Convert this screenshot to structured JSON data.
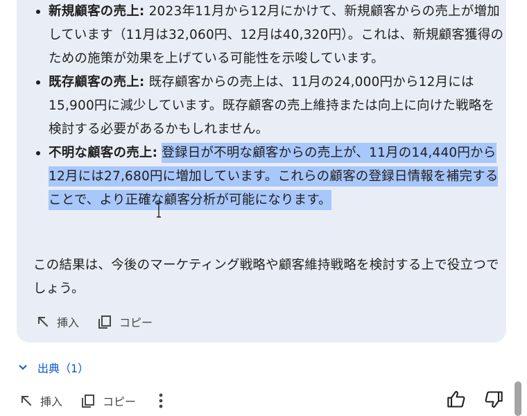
{
  "bullets": [
    {
      "label": "新規顧客の売上:",
      "text": " 2023年11月から12月にかけて、新規顧客からの売上が増加しています（11月は32,060円、12月は40,320円）。これは、新規顧客獲得のための施策が効果を上げている可能性を示唆しています。"
    },
    {
      "label": "既存顧客の売上:",
      "text": " 既存顧客からの売上は、11月の24,000円から12月には15,900円に減少しています。既存顧客の売上維持または向上に向けた戦略を検討する必要があるかもしれません。"
    },
    {
      "label": "不明な顧客の売上:",
      "text_plain": " ",
      "text_selected": "登録日が不明な顧客からの売上が、11月の14,440円から12月には27,680円に増加しています。これらの顧客の登録日情報を補完することで、より正確な顧客分析が可能になります。"
    }
  ],
  "summary": "この結果は、今後のマーケティング戦略や顧客維持戦略を検討する上で役立つでしょう。",
  "card_actions": {
    "insert": "挿入",
    "copy": "コピー"
  },
  "sources": {
    "label": "出典（1）"
  },
  "bottom_actions": {
    "insert": "挿入",
    "copy": "コピー"
  },
  "icons": {
    "insert": "arrow-up-left-icon",
    "copy": "copy-icon",
    "chevron": "chevron-down-icon",
    "more": "more-vert-icon",
    "like": "thumb-up-icon",
    "dislike": "thumb-down-icon"
  },
  "colors": {
    "card_bg": "#e9eef6",
    "selection": "#a8c7fa",
    "link": "#0b57d0",
    "text": "#1f1f1f",
    "icon": "#444746"
  }
}
